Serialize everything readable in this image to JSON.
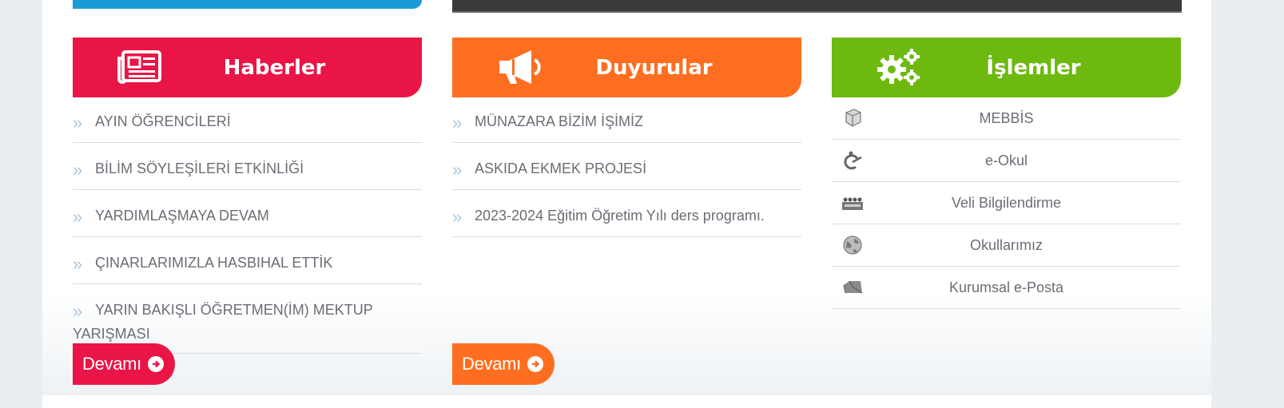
{
  "news": {
    "title": "Haberler",
    "items": [
      "AYIN ÖĞRENCİLERİ",
      "BİLİM SÖYLEŞİLERİ ETKİNLİĞİ",
      "YARDIMLAŞMAYA DEVAM",
      "ÇINARLARIMIZLA HASBIHAL ETTİK",
      "YARIN BAKIŞLI ÖĞRETMEN(İM) MEKTUP YARIŞMASI"
    ],
    "more_label": "Devamı",
    "color": "#ea1547"
  },
  "announcements": {
    "title": "Duyurular",
    "items": [
      "MÜNAZARA BİZİM İŞİMİZ",
      "ASKIDA EKMEK PROJESİ",
      "2023-2024 Eğitim Öğretim Yılı ders programı."
    ],
    "more_label": "Devamı",
    "color": "#fe6e20"
  },
  "operations": {
    "title": "İşlemler",
    "items": [
      {
        "label": "MEBBİS",
        "icon": "mebbis-icon"
      },
      {
        "label": "e-Okul",
        "icon": "eokul-icon"
      },
      {
        "label": "Veli Bilgilendirme",
        "icon": "parents-icon"
      },
      {
        "label": "Okullarımız",
        "icon": "globe-icon"
      },
      {
        "label": "Kurumsal e-Posta",
        "icon": "mail-icon"
      }
    ],
    "color": "#6db90f"
  },
  "icons": {
    "news_header": "newspaper-icon",
    "announcements_header": "megaphone-icon",
    "operations_header": "gears-icon",
    "list_bullet": "double-chevron-icon"
  }
}
